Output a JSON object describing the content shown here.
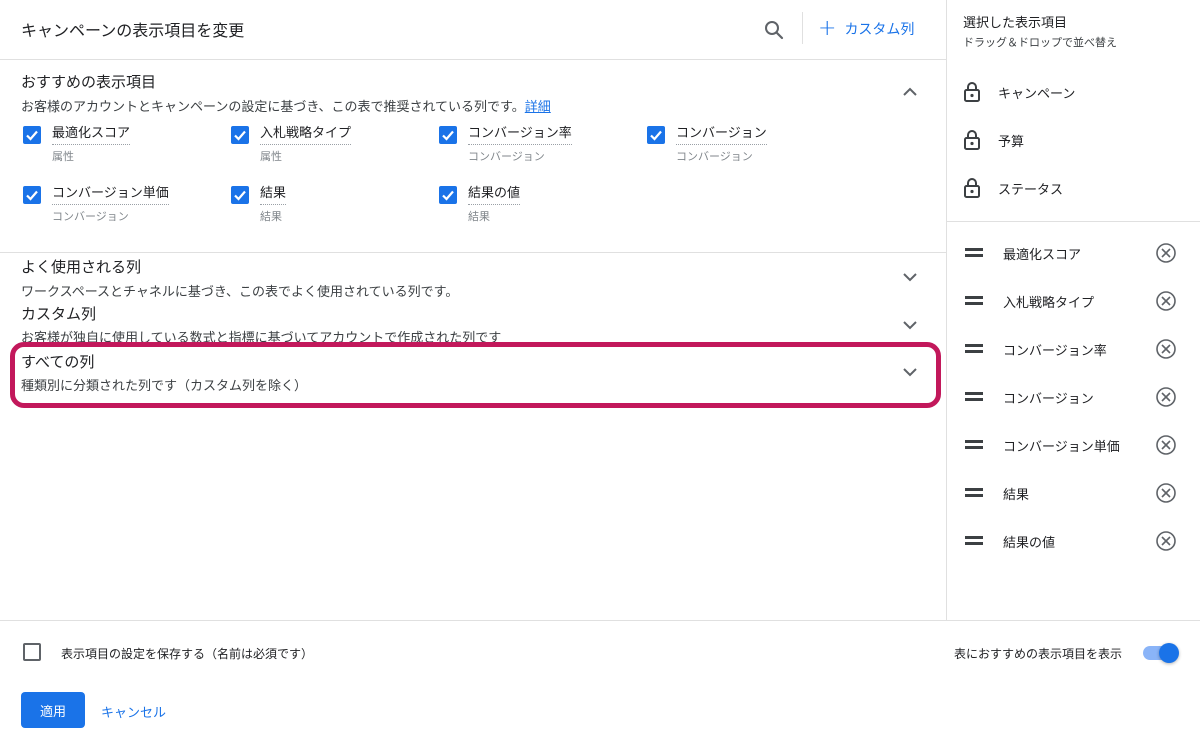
{
  "header": {
    "title": "キャンペーンの表示項目を変更",
    "search_icon": "search-icon",
    "custom_column_label": "カスタム列"
  },
  "recommended": {
    "title": "おすすめの表示項目",
    "description": "お客様のアカウントとキャンペーンの設定に基づき、この表で推奨されている列です。",
    "details_link": "詳細",
    "items": [
      {
        "label": "最適化スコア",
        "category": "属性",
        "checked": true
      },
      {
        "label": "入札戦略タイプ",
        "category": "属性",
        "checked": true
      },
      {
        "label": "コンバージョン率",
        "category": "コンバージョン",
        "checked": true
      },
      {
        "label": "コンバージョン",
        "category": "コンバージョン",
        "checked": true
      },
      {
        "label": "コンバージョン単価",
        "category": "コンバージョン",
        "checked": true
      },
      {
        "label": "結果",
        "category": "結果",
        "checked": true
      },
      {
        "label": "結果の値",
        "category": "結果",
        "checked": true
      }
    ]
  },
  "sections": [
    {
      "title": "よく使用される列",
      "description": "ワークスペースとチャネルに基づき、この表でよく使用されている列です。"
    },
    {
      "title": "カスタム列",
      "description": "お客様が独自に使用している数式と指標に基づいてアカウントで作成された列です"
    },
    {
      "title": "すべての列",
      "description": "種類別に分類された列です（カスタム列を除く）"
    }
  ],
  "right_panel": {
    "title": "選択した表示項目",
    "subtitle": "ドラッグ＆ドロップで並べ替え",
    "locked": [
      "キャンペーン",
      "予算",
      "ステータス"
    ],
    "selected": [
      "最適化スコア",
      "入札戦略タイプ",
      "コンバージョン率",
      "コンバージョン",
      "コンバージョン単価",
      "結果",
      "結果の値"
    ]
  },
  "footer": {
    "save_label": "表示項目の設定を保存する（名前は必須です）",
    "save_checked": false,
    "toggle_label": "表におすすめの表示項目を表示",
    "toggle_on": true,
    "apply_label": "適用",
    "cancel_label": "キャンセル"
  },
  "colors": {
    "accent": "#1a73e8",
    "highlight": "#c2185b"
  }
}
